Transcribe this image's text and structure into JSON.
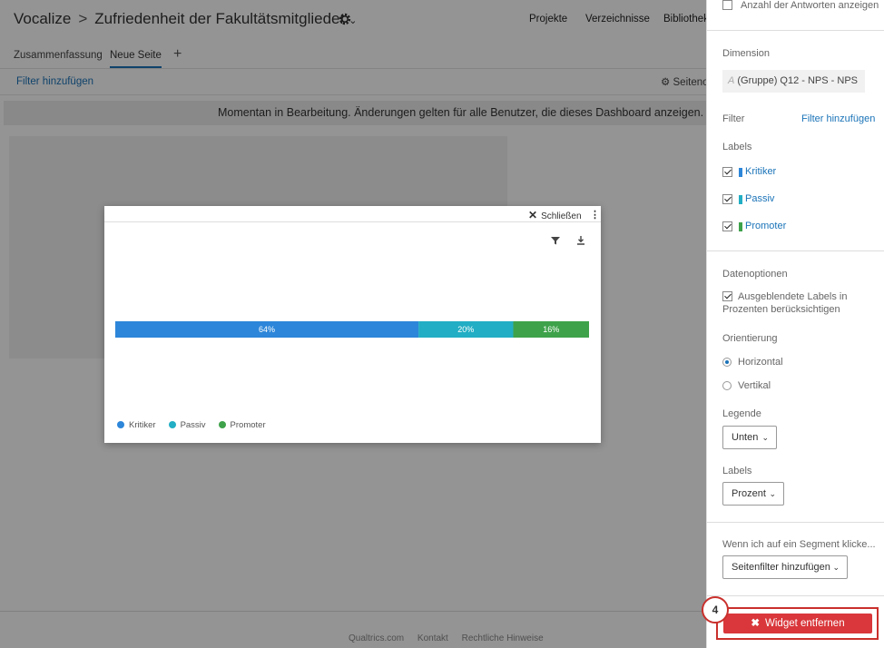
{
  "header": {
    "brand": "Vocalize",
    "project_title": "Zufriedenheit der Fakultätsmitglieder",
    "nav": [
      "Projekte",
      "Verzeichnisse",
      "Bibliothek"
    ]
  },
  "tabs": {
    "summary": "Zusammenfassung",
    "new_page": "Neue Seite"
  },
  "filterbar": {
    "add_filter": "Filter hinzufügen",
    "page_options": "Seitenoptionen"
  },
  "banner": {
    "text": "Momentan in Bearbeitung. Änderungen gelten für alle Benutzer, die dieses Dashboard anzeigen."
  },
  "modal": {
    "close_label": "Schließen"
  },
  "chart_data": {
    "type": "bar",
    "orientation": "horizontal",
    "stacked": true,
    "categories": [
      "Kritiker",
      "Passiv",
      "Promoter"
    ],
    "values": [
      64,
      20,
      16
    ],
    "value_labels": [
      "64%",
      "20%",
      "16%"
    ],
    "colors": [
      "#2d86d9",
      "#22aec4",
      "#3ea24a"
    ],
    "legend_position": "bottom"
  },
  "panel": {
    "show_count": "Anzahl der Antworten anzeigen",
    "dimension_label": "Dimension",
    "dimension_value": "(Gruppe) Q12 - NPS - NPS",
    "filter_label": "Filter",
    "filter_add": "Filter hinzufügen",
    "labels_label": "Labels",
    "labels": [
      {
        "text": "Kritiker",
        "color": "#2d86d9"
      },
      {
        "text": "Passiv",
        "color": "#22aec4"
      },
      {
        "text": "Promoter",
        "color": "#3ea24a"
      }
    ],
    "data_options_label": "Datenoptionen",
    "hidden_labels_line1": "Ausgeblendete Labels in",
    "hidden_labels_line2": "Prozenten berücksichtigen",
    "orientation_label": "Orientierung",
    "horizontal": "Horizontal",
    "vertical": "Vertikal",
    "legend_label": "Legende",
    "legend_value": "Unten",
    "labels2_label": "Labels",
    "labels2_value": "Prozent",
    "segment_label": "Wenn ich auf ein Segment klicke...",
    "segment_value": "Seitenfilter hinzufügen",
    "remove_button": "Widget entfernen",
    "step_number": "4"
  },
  "footer": {
    "links": [
      "Qualtrics.com",
      "Kontakt",
      "Rechtliche Hinweise"
    ]
  }
}
